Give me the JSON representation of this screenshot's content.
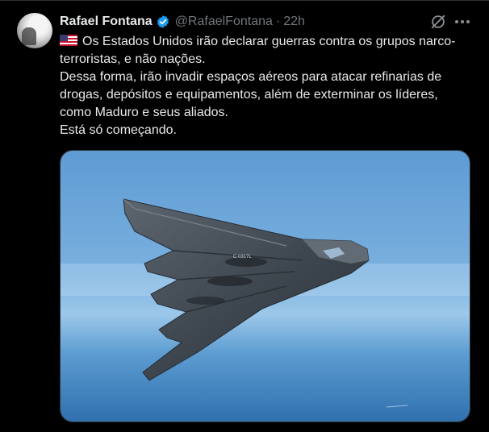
{
  "tweet": {
    "author_name": "Rafael Fontana",
    "handle": "@RafaelFontana",
    "separator": "·",
    "time": "22h",
    "lines": [
      "Os Estados Unidos irão declarar guerras contra os grupos narco-terroristas, e não nações.",
      "Dessa forma, irão invadir espaços aéreos para atacar refinarias de drogas, depósitos e equipamentos, além de exterminar os líderes, como Maduro e seus aliados.",
      "Está só começando."
    ],
    "media_marking": "C 0317L"
  },
  "icons": {
    "verified": "verified-badge-icon",
    "flag": "us-flag-icon",
    "grok": "grok-icon",
    "more": "more-horizontal-icon"
  },
  "colors": {
    "background": "#000000",
    "text": "#e7e9ea",
    "secondary": "#71767b",
    "verified": "#1d9bf0"
  }
}
